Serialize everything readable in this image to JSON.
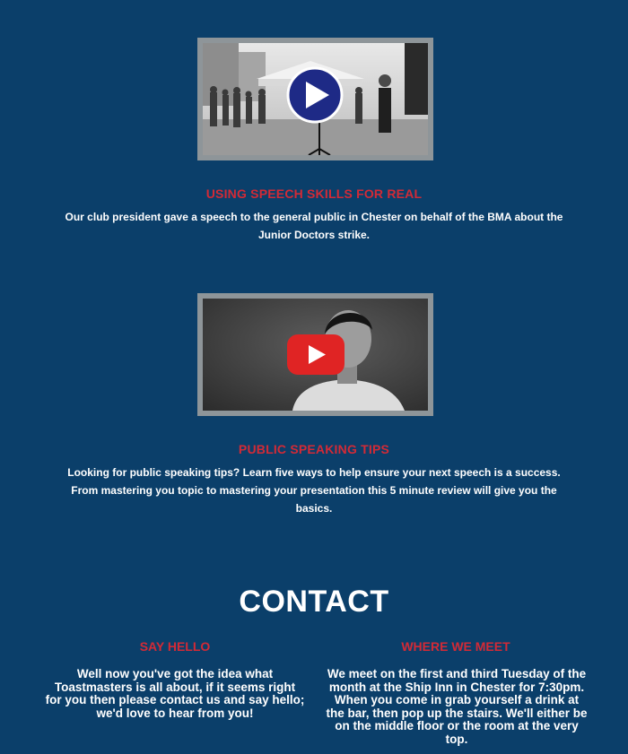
{
  "videos": [
    {
      "title": "USING SPEECH SKILLS FOR REAL",
      "description": "Our club president gave a speech to the general public in Chester on behalf of the BMA about the Junior Doctors strike.",
      "thumbnail_icon": "play-circle-icon"
    },
    {
      "title": "PUBLIC SPEAKING TIPS",
      "description": "Looking for public speaking tips? Learn five ways to help ensure your next speech is a success. From mastering you topic to mastering your presentation this 5 minute review will give you the basics.",
      "thumbnail_icon": "youtube-play-icon"
    }
  ],
  "contact": {
    "heading": "CONTACT",
    "say_hello": {
      "title": "SAY HELLO",
      "body": "Well now you've got the idea what Toastmasters is all about, if it seems right for you then please contact us and say hello; we'd love to hear from you!"
    },
    "where_we_meet": {
      "title": "WHERE WE MEET",
      "body": "We meet on the first and third Tuesday of the month at the Ship Inn in Chester for 7:30pm. When you come in grab yourself a drink at the bar, then pop up the stairs. We'll either be on the middle floor or the room at the very top."
    }
  },
  "colors": {
    "background": "#0b3f6a",
    "accent_red": "#d32a36",
    "frame_gray": "#8e9599",
    "text": "#ffffff"
  }
}
